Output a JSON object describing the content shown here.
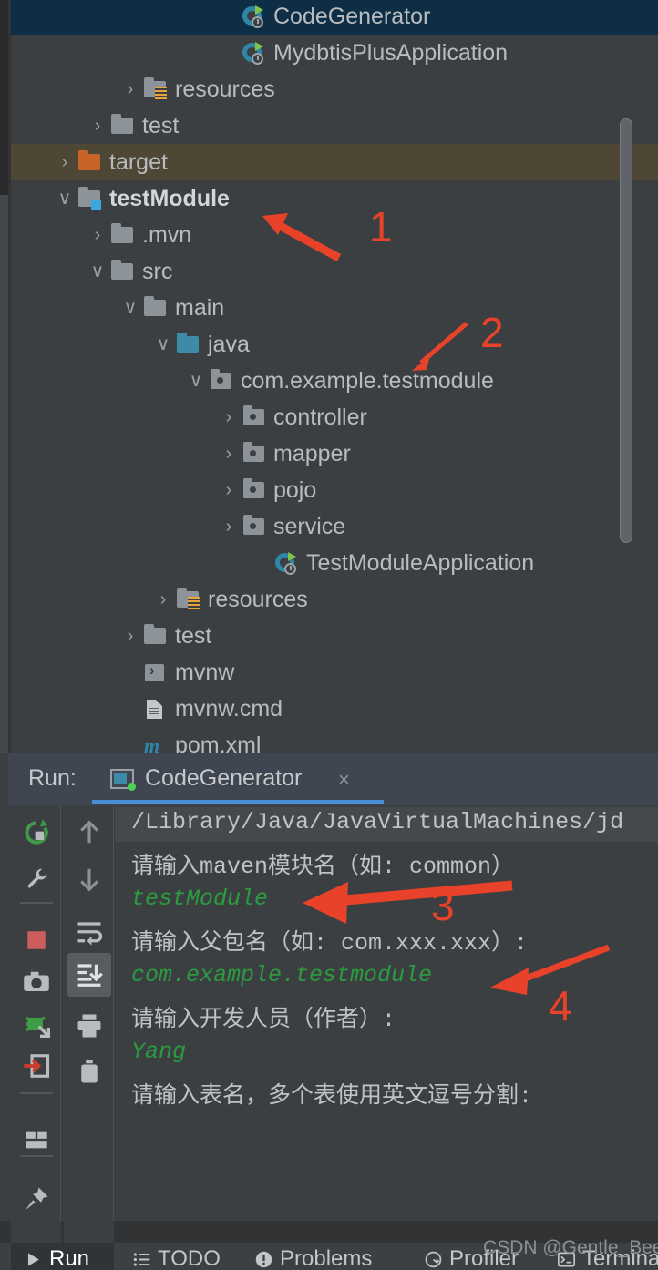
{
  "project_tree": {
    "rows": [
      {
        "label": "CodeGenerator",
        "indent": 6,
        "chevron": "",
        "icon": "spring-boot-app-icon",
        "state": "selected-blue",
        "bold": false
      },
      {
        "label": "MydbtisPlusApplication",
        "indent": 6,
        "chevron": "",
        "icon": "spring-boot-app-icon",
        "state": "normal",
        "bold": false
      },
      {
        "label": "resources",
        "indent": 3,
        "chevron": "›",
        "icon": "resources-folder-icon",
        "state": "normal",
        "bold": false
      },
      {
        "label": "test",
        "indent": 2,
        "chevron": "›",
        "icon": "folder-icon",
        "state": "normal",
        "bold": false
      },
      {
        "label": "target",
        "indent": 1,
        "chevron": "›",
        "icon": "folder-orange-icon",
        "state": "selected-olive",
        "bold": false
      },
      {
        "label": "testModule",
        "indent": 1,
        "chevron": "∨",
        "icon": "module-folder-icon",
        "state": "normal",
        "bold": true
      },
      {
        "label": ".mvn",
        "indent": 2,
        "chevron": "›",
        "icon": "folder-icon",
        "state": "normal",
        "bold": false
      },
      {
        "label": "src",
        "indent": 2,
        "chevron": "∨",
        "icon": "folder-icon",
        "state": "normal",
        "bold": false
      },
      {
        "label": "main",
        "indent": 3,
        "chevron": "∨",
        "icon": "folder-icon",
        "state": "normal",
        "bold": false
      },
      {
        "label": "java",
        "indent": 4,
        "chevron": "∨",
        "icon": "folder-blue-icon",
        "state": "normal",
        "bold": false
      },
      {
        "label": "com.example.testmodule",
        "indent": 5,
        "chevron": "∨",
        "icon": "package-icon",
        "state": "normal",
        "bold": false
      },
      {
        "label": "controller",
        "indent": 6,
        "chevron": "›",
        "icon": "package-icon",
        "state": "normal",
        "bold": false
      },
      {
        "label": "mapper",
        "indent": 6,
        "chevron": "›",
        "icon": "package-icon",
        "state": "normal",
        "bold": false
      },
      {
        "label": "pojo",
        "indent": 6,
        "chevron": "›",
        "icon": "package-icon",
        "state": "normal",
        "bold": false
      },
      {
        "label": "service",
        "indent": 6,
        "chevron": "›",
        "icon": "package-icon",
        "state": "normal",
        "bold": false
      },
      {
        "label": "TestModuleApplication",
        "indent": 7,
        "chevron": "",
        "icon": "spring-boot-app-icon",
        "state": "normal",
        "bold": false
      },
      {
        "label": "resources",
        "indent": 4,
        "chevron": "›",
        "icon": "resources-folder-icon",
        "state": "normal",
        "bold": false
      },
      {
        "label": "test",
        "indent": 3,
        "chevron": "›",
        "icon": "folder-icon",
        "state": "normal",
        "bold": false
      },
      {
        "label": "mvnw",
        "indent": 3,
        "chevron": "",
        "icon": "shell-script-icon",
        "state": "normal",
        "bold": false
      },
      {
        "label": "mvnw.cmd",
        "indent": 3,
        "chevron": "",
        "icon": "cmd-file-icon",
        "state": "normal",
        "bold": false
      },
      {
        "label": "pom.xml",
        "indent": 3,
        "chevron": "",
        "icon": "maven-pom-icon",
        "state": "normal",
        "bold": false
      }
    ]
  },
  "run_panel": {
    "run_label": "Run:",
    "tab_title": "CodeGenerator",
    "close_label": "×",
    "toolbar_left": [
      "rerun-icon",
      "wrench-settings-icon",
      "stop-icon",
      "camera-snapshot-icon",
      "debug-thread-icon",
      "export-icon",
      "layout-icon",
      "pin-icon"
    ],
    "toolbar_right": [
      "scroll-up-icon",
      "scroll-down-icon",
      "soft-wrap-icon",
      "scroll-to-end-icon",
      "print-icon",
      "trash-icon"
    ]
  },
  "console": {
    "lines": [
      {
        "text": "/Library/Java/JavaVirtualMachines/jd",
        "color": "gray",
        "highlight": true
      },
      {
        "text": "请输入maven模块名（如: common）",
        "color": "gray",
        "highlight": false
      },
      {
        "text": "testModule",
        "color": "green",
        "highlight": false
      },
      {
        "text": "请输入父包名（如: com.xxx.xxx）:",
        "color": "gray",
        "highlight": false
      },
      {
        "text": "com.example.testmodule",
        "color": "green",
        "highlight": false
      },
      {
        "text": "请输入开发人员（作者）:",
        "color": "gray",
        "highlight": false
      },
      {
        "text": "Yang",
        "color": "green",
        "highlight": false
      },
      {
        "text": "请输入表名，多个表使用英文逗号分割:",
        "color": "gray",
        "highlight": false
      }
    ]
  },
  "status_bar": {
    "items": [
      {
        "label": "Run",
        "icon": "play-icon",
        "active": true
      },
      {
        "label": "TODO",
        "icon": "list-icon",
        "active": false
      },
      {
        "label": "Problems",
        "icon": "warning-icon",
        "active": false
      },
      {
        "label": "Profiler",
        "icon": "gauge-icon",
        "active": false
      },
      {
        "label": "Terminal",
        "icon": "terminal-icon",
        "active": false
      }
    ]
  },
  "annotations": {
    "color": "#e8432a",
    "markers": [
      {
        "number": "1",
        "target": "testModule tree node"
      },
      {
        "number": "2",
        "target": "com.example.testmodule package node"
      },
      {
        "number": "3",
        "target": "testModule console input"
      },
      {
        "number": "4",
        "target": "com.example.testmodule console input"
      }
    ]
  },
  "watermark": {
    "text": "CSDN @Gentle_Bee"
  }
}
